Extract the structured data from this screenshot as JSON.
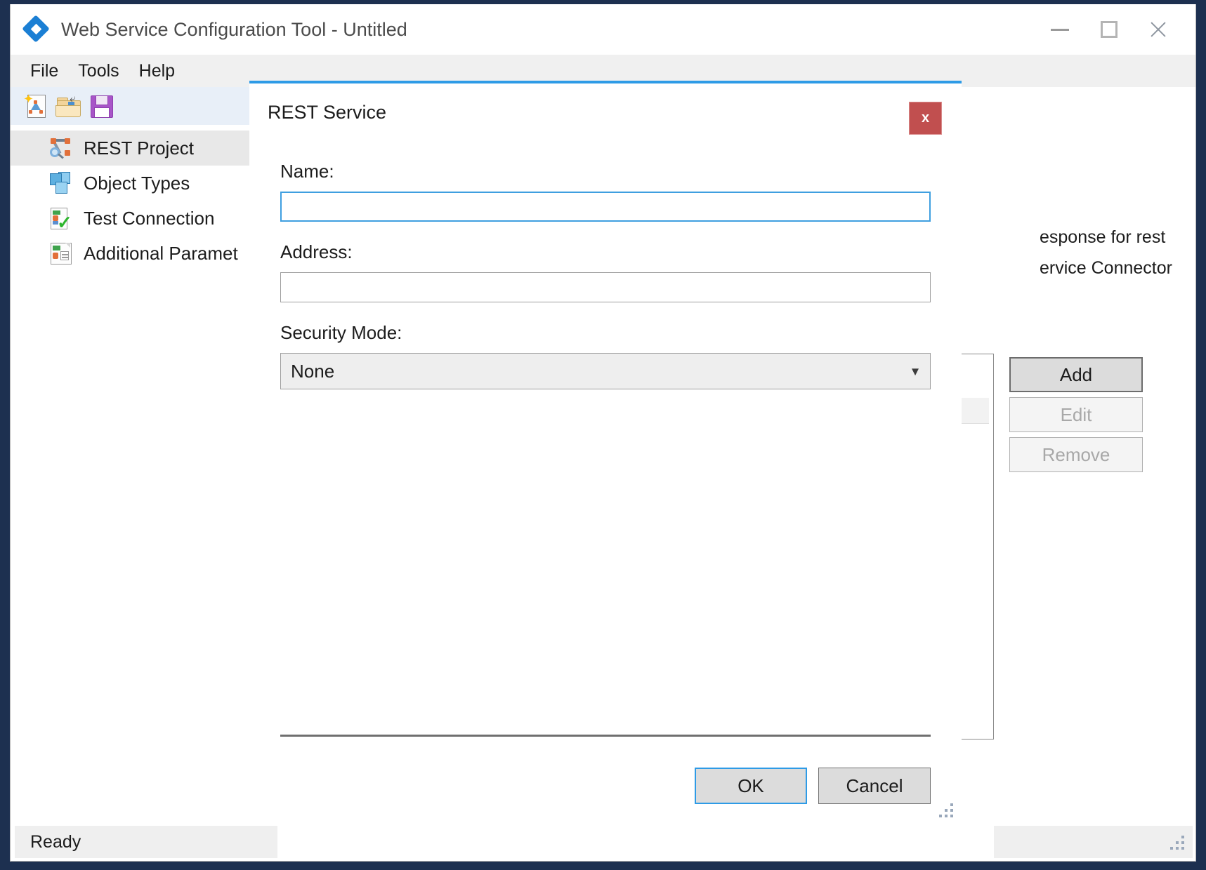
{
  "window": {
    "title": "Web Service Configuration Tool - Untitled",
    "app_icon": "app-diamond-icon",
    "controls": {
      "minimize": "minimize-icon",
      "maximize": "maximize-icon",
      "close": "close-icon"
    }
  },
  "menu": {
    "items": [
      {
        "label": "File"
      },
      {
        "label": "Tools"
      },
      {
        "label": "Help"
      }
    ]
  },
  "toolbar": {
    "items": [
      {
        "icon": "new-document-icon",
        "tooltip": "New"
      },
      {
        "icon": "open-folder-icon",
        "tooltip": "Open"
      },
      {
        "icon": "save-floppy-icon",
        "tooltip": "Save"
      }
    ]
  },
  "sidebar": {
    "items": [
      {
        "label": "REST Project",
        "icon": "rest-project-icon",
        "selected": true
      },
      {
        "label": "Object Types",
        "icon": "object-types-icon",
        "selected": false
      },
      {
        "label": "Test Connection",
        "icon": "test-connection-icon",
        "selected": false
      },
      {
        "label": "Additional Paramet",
        "icon": "additional-parameter-icon",
        "selected": false
      }
    ]
  },
  "background": {
    "description_line1": "esponse for rest",
    "description_line2": "ervice Connector",
    "buttons": {
      "add": "Add",
      "edit": "Edit",
      "remove": "Remove"
    }
  },
  "dialog": {
    "title": "REST Service",
    "close_label": "x",
    "fields": {
      "name": {
        "label": "Name:",
        "value": "",
        "placeholder": "",
        "focused": true
      },
      "address": {
        "label": "Address:",
        "value": "",
        "placeholder": "",
        "focused": false
      },
      "security_mode": {
        "label": "Security Mode:",
        "value": "None",
        "options": [
          "None"
        ]
      }
    },
    "buttons": {
      "ok": "OK",
      "cancel": "Cancel"
    }
  },
  "status": {
    "text": "Ready"
  },
  "colors": {
    "accent_blue": "#2e9be6",
    "dialog_close_red": "#c14f4f",
    "selection_gray": "#e8e8e8",
    "toolbar_blue": "#e8eff8"
  }
}
